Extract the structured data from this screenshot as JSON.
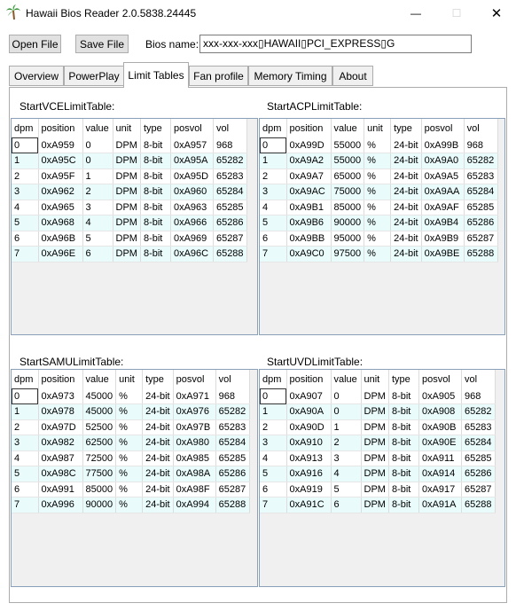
{
  "window": {
    "title": "Hawaii Bios Reader 2.0.5838.24445",
    "icon": "palm-tree-icon",
    "min_glyph": "—",
    "max_glyph": "☐",
    "close_glyph": "✕"
  },
  "toolbar": {
    "open_label": "Open File",
    "save_label": "Save File",
    "bios_name_label": "Bios name:",
    "bios_name_value": "xxx-xxx-xxx▯HAWAII▯PCI_EXPRESS▯G"
  },
  "tabs": [
    {
      "label": "Overview"
    },
    {
      "label": "PowerPlay"
    },
    {
      "label": "Limit Tables"
    },
    {
      "label": "Fan profile"
    },
    {
      "label": "Memory Timing"
    },
    {
      "label": "About"
    }
  ],
  "active_tab": "Limit Tables",
  "colors": {
    "alt_row": "#e9fbfb",
    "grid_border": "#8aa0b8"
  },
  "tables": {
    "vce": {
      "title": "StartVCELimitTable:",
      "headers": [
        "dpm",
        "position",
        "value",
        "unit",
        "type",
        "posvol",
        "vol"
      ],
      "rows": [
        [
          "0",
          "0xA959",
          "0",
          "DPM",
          "8-bit",
          "0xA957",
          "968"
        ],
        [
          "1",
          "0xA95C",
          "0",
          "DPM",
          "8-bit",
          "0xA95A",
          "65282"
        ],
        [
          "2",
          "0xA95F",
          "1",
          "DPM",
          "8-bit",
          "0xA95D",
          "65283"
        ],
        [
          "3",
          "0xA962",
          "2",
          "DPM",
          "8-bit",
          "0xA960",
          "65284"
        ],
        [
          "4",
          "0xA965",
          "3",
          "DPM",
          "8-bit",
          "0xA963",
          "65285"
        ],
        [
          "5",
          "0xA968",
          "4",
          "DPM",
          "8-bit",
          "0xA966",
          "65286"
        ],
        [
          "6",
          "0xA96B",
          "5",
          "DPM",
          "8-bit",
          "0xA969",
          "65287"
        ],
        [
          "7",
          "0xA96E",
          "6",
          "DPM",
          "8-bit",
          "0xA96C",
          "65288"
        ]
      ]
    },
    "acp": {
      "title": "StartACPLimitTable:",
      "headers": [
        "dpm",
        "position",
        "value",
        "unit",
        "type",
        "posvol",
        "vol"
      ],
      "rows": [
        [
          "0",
          "0xA99D",
          "55000",
          "%",
          "24-bit",
          "0xA99B",
          "968"
        ],
        [
          "1",
          "0xA9A2",
          "55000",
          "%",
          "24-bit",
          "0xA9A0",
          "65282"
        ],
        [
          "2",
          "0xA9A7",
          "65000",
          "%",
          "24-bit",
          "0xA9A5",
          "65283"
        ],
        [
          "3",
          "0xA9AC",
          "75000",
          "%",
          "24-bit",
          "0xA9AA",
          "65284"
        ],
        [
          "4",
          "0xA9B1",
          "85000",
          "%",
          "24-bit",
          "0xA9AF",
          "65285"
        ],
        [
          "5",
          "0xA9B6",
          "90000",
          "%",
          "24-bit",
          "0xA9B4",
          "65286"
        ],
        [
          "6",
          "0xA9BB",
          "95000",
          "%",
          "24-bit",
          "0xA9B9",
          "65287"
        ],
        [
          "7",
          "0xA9C0",
          "97500",
          "%",
          "24-bit",
          "0xA9BE",
          "65288"
        ]
      ]
    },
    "samu": {
      "title": "StartSAMULimitTable:",
      "headers": [
        "dpm",
        "position",
        "value",
        "unit",
        "type",
        "posvol",
        "vol"
      ],
      "rows": [
        [
          "0",
          "0xA973",
          "45000",
          "%",
          "24-bit",
          "0xA971",
          "968"
        ],
        [
          "1",
          "0xA978",
          "45000",
          "%",
          "24-bit",
          "0xA976",
          "65282"
        ],
        [
          "2",
          "0xA97D",
          "52500",
          "%",
          "24-bit",
          "0xA97B",
          "65283"
        ],
        [
          "3",
          "0xA982",
          "62500",
          "%",
          "24-bit",
          "0xA980",
          "65284"
        ],
        [
          "4",
          "0xA987",
          "72500",
          "%",
          "24-bit",
          "0xA985",
          "65285"
        ],
        [
          "5",
          "0xA98C",
          "77500",
          "%",
          "24-bit",
          "0xA98A",
          "65286"
        ],
        [
          "6",
          "0xA991",
          "85000",
          "%",
          "24-bit",
          "0xA98F",
          "65287"
        ],
        [
          "7",
          "0xA996",
          "90000",
          "%",
          "24-bit",
          "0xA994",
          "65288"
        ]
      ]
    },
    "uvd": {
      "title": "StartUVDLimitTable:",
      "headers": [
        "dpm",
        "position",
        "value",
        "unit",
        "type",
        "posvol",
        "vol"
      ],
      "rows": [
        [
          "0",
          "0xA907",
          "0",
          "DPM",
          "8-bit",
          "0xA905",
          "968"
        ],
        [
          "1",
          "0xA90A",
          "0",
          "DPM",
          "8-bit",
          "0xA908",
          "65282"
        ],
        [
          "2",
          "0xA90D",
          "1",
          "DPM",
          "8-bit",
          "0xA90B",
          "65283"
        ],
        [
          "3",
          "0xA910",
          "2",
          "DPM",
          "8-bit",
          "0xA90E",
          "65284"
        ],
        [
          "4",
          "0xA913",
          "3",
          "DPM",
          "8-bit",
          "0xA911",
          "65285"
        ],
        [
          "5",
          "0xA916",
          "4",
          "DPM",
          "8-bit",
          "0xA914",
          "65286"
        ],
        [
          "6",
          "0xA919",
          "5",
          "DPM",
          "8-bit",
          "0xA917",
          "65287"
        ],
        [
          "7",
          "0xA91C",
          "6",
          "DPM",
          "8-bit",
          "0xA91A",
          "65288"
        ]
      ]
    }
  }
}
